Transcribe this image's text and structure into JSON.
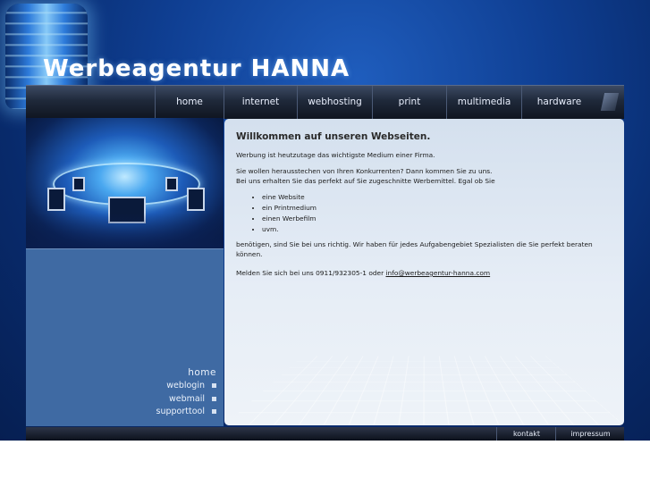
{
  "brand": {
    "title": "Werbeagentur HANNA"
  },
  "topnav": {
    "items": [
      {
        "label": "home"
      },
      {
        "label": "internet"
      },
      {
        "label": "webhosting"
      },
      {
        "label": "print"
      },
      {
        "label": "multimedia"
      },
      {
        "label": "hardware"
      }
    ]
  },
  "sidebar": {
    "links": [
      {
        "label": "home"
      },
      {
        "label": "weblogin"
      },
      {
        "label": "webmail"
      },
      {
        "label": "supporttool"
      }
    ]
  },
  "content": {
    "title": "Willkommen auf unseren Webseiten.",
    "intro": "Werbung ist heutzutage das wichtigste Medium einer Firma.",
    "line1": "Sie wollen herausstechen von Ihren Konkurrenten? Dann kommen Sie zu uns.",
    "line2": "Bei uns erhalten Sie das perfekt auf Sie zugeschnitte Werbemittel. Egal ob Sie",
    "list": [
      "eine Website",
      "ein Printmedium",
      "einen Werbefilm",
      "uvm."
    ],
    "after_list": "benötigen, sind Sie bei uns richtig. Wir haben für jedes Aufgabengebiet Spezialisten die Sie perfekt beraten können.",
    "contact_prefix": "Melden Sie sich bei uns 0911/932305-1 oder ",
    "contact_email": "info@werbeagentur-hanna.com"
  },
  "footer": {
    "links": [
      {
        "label": "kontakt"
      },
      {
        "label": "impressum"
      }
    ]
  },
  "colors": {
    "background_blue": "#0f3f93",
    "sidebar_blue": "#3f6aa3",
    "content_panel": "#e6edf6"
  },
  "icons": {
    "logo_graphic": "glowing-cylinder-logo",
    "hero_image": "computer-network-ring"
  }
}
